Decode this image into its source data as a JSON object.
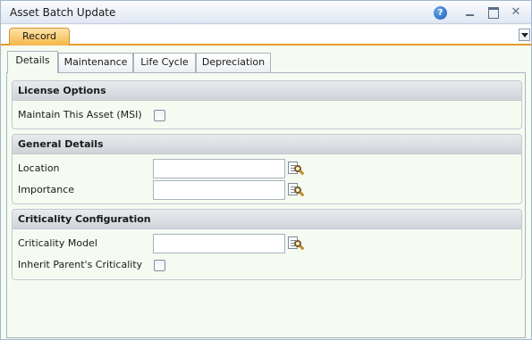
{
  "window": {
    "title": "Asset Batch Update",
    "help_glyph": "?",
    "close_glyph": "✕"
  },
  "record_tab": {
    "label": "Record"
  },
  "tabs": [
    {
      "label": "Details",
      "active": true
    },
    {
      "label": "Maintenance",
      "active": false
    },
    {
      "label": "Life Cycle",
      "active": false
    },
    {
      "label": "Depreciation",
      "active": false
    }
  ],
  "sections": {
    "license": {
      "title": "License Options",
      "maintain_label": "Maintain This Asset (MSI)",
      "maintain_checked": false
    },
    "general": {
      "title": "General Details",
      "location_label": "Location",
      "location_value": "",
      "importance_label": "Importance",
      "importance_value": ""
    },
    "criticality": {
      "title": "Criticality Configuration",
      "model_label": "Criticality Model",
      "model_value": "",
      "inherit_label": "Inherit Parent's Criticality",
      "inherit_checked": false
    }
  },
  "colors": {
    "accent_tab": "#f5b649",
    "panel_background": "#f5fbf1"
  },
  "icons": [
    "help-icon",
    "minimize-icon",
    "maximize-icon",
    "close-icon",
    "dropdown-icon",
    "lookup-icon"
  ]
}
